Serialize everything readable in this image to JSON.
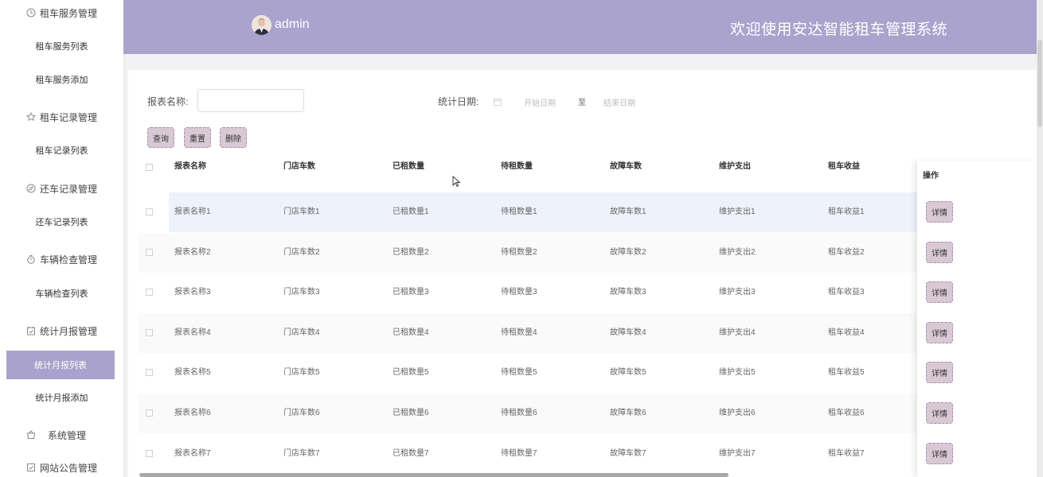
{
  "sidebar": {
    "groups": [
      {
        "label": "租车服务管理",
        "icon": "clock-icon",
        "items": [
          "租车服务列表",
          "租车服务添加"
        ]
      },
      {
        "label": "租车记录管理",
        "icon": "star-icon",
        "items": [
          "租车记录列表"
        ]
      },
      {
        "label": "还车记录管理",
        "icon": "compass-icon",
        "items": [
          "还车记录列表"
        ]
      },
      {
        "label": "车辆检查管理",
        "icon": "timer-icon",
        "items": [
          "车辆检查列表"
        ]
      },
      {
        "label": "统计月报管理",
        "icon": "calendar-check-icon",
        "items": [
          "统计月报列表",
          "统计月报添加"
        ]
      },
      {
        "label": "系统管理",
        "icon": "basket-icon",
        "items": []
      },
      {
        "label": "网站公告管理",
        "icon": "checkbox-icon",
        "items": []
      }
    ],
    "active_item": "统计月报列表"
  },
  "header": {
    "user": "admin",
    "welcome": "欢迎使用安达智能租车管理系统"
  },
  "search": {
    "report_name_label": "报表名称:",
    "report_name_value": "",
    "date_label": "统计日期:",
    "start_placeholder": "开始日期",
    "separator": "至",
    "end_placeholder": "结束日期"
  },
  "buttons": {
    "query": "查询",
    "reset": "重置",
    "delete": "删除"
  },
  "table": {
    "columns": [
      "报表名称",
      "门店车数",
      "已租数量",
      "待租数量",
      "故障车数",
      "维护支出",
      "租车收益",
      "操作"
    ],
    "rows": [
      [
        "报表名称1",
        "门店车数1",
        "已租数量1",
        "待租数量1",
        "故障车数1",
        "维护支出1",
        "租车收益1"
      ],
      [
        "报表名称2",
        "门店车数2",
        "已租数量2",
        "待租数量2",
        "故障车数2",
        "维护支出2",
        "租车收益2"
      ],
      [
        "报表名称3",
        "门店车数3",
        "已租数量3",
        "待租数量3",
        "故障车数3",
        "维护支出3",
        "租车收益3"
      ],
      [
        "报表名称4",
        "门店车数4",
        "已租数量4",
        "待租数量4",
        "故障车数4",
        "维护支出4",
        "租车收益4"
      ],
      [
        "报表名称5",
        "门店车数5",
        "已租数量5",
        "待租数量5",
        "故障车数5",
        "维护支出5",
        "租车收益5"
      ],
      [
        "报表名称6",
        "门店车数6",
        "已租数量6",
        "待租数量6",
        "故障车数6",
        "维护支出6",
        "租车收益6"
      ],
      [
        "报表名称7",
        "门店车数7",
        "已租数量7",
        "待租数量7",
        "故障车数7",
        "维护支出7",
        "租车收益7"
      ]
    ],
    "action_label": "详情"
  },
  "colors": {
    "header_bg": "#aaa3cd",
    "active_menu_bg": "#a9a2cc",
    "button_bg": "#d8c9d4",
    "button_border": "#a88bb1",
    "highlight_row": "#eef2fb"
  }
}
